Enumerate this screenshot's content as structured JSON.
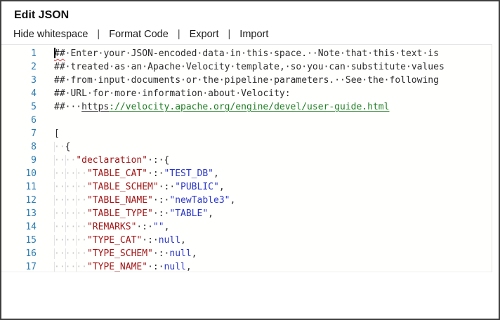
{
  "dialog": {
    "title": "Edit JSON"
  },
  "toolbar": {
    "separator": "|",
    "items": [
      {
        "label": "Hide whitespace"
      },
      {
        "label": "Format Code"
      },
      {
        "label": "Export"
      },
      {
        "label": "Import"
      }
    ]
  },
  "colors": {
    "line_number": "#2c7cb0",
    "json_key": "#a31515",
    "json_value": "#2b38cb",
    "link_green": "#1f7e23",
    "squiggle_red": "#e23b3b",
    "whitespace_dot": "#c6c6c6",
    "indent_guide": "#e3e3e3"
  },
  "editor": {
    "link_url": "https://velocity.apache.org/engine/devel/user-guide.html",
    "lines": [
      {
        "n": "1",
        "indent": 0,
        "cursor": true,
        "segments": [
          {
            "t": "##",
            "c": "comment sq"
          },
          {
            "t": " Enter your JSON-encoded data in this space.  Note that this text is",
            "c": "comment"
          }
        ]
      },
      {
        "n": "2",
        "indent": 0,
        "segments": [
          {
            "t": "## treated as an Apache Velocity template, so you can substitute values",
            "c": "comment"
          }
        ]
      },
      {
        "n": "3",
        "indent": 0,
        "segments": [
          {
            "t": "## from input documents or the pipeline parameters.  See the following",
            "c": "comment"
          }
        ]
      },
      {
        "n": "4",
        "indent": 0,
        "segments": [
          {
            "t": "## URL for more information about Velocity:",
            "c": "comment"
          }
        ]
      },
      {
        "n": "5",
        "indent": 0,
        "segments": [
          {
            "t": "##   ",
            "c": "comment"
          },
          {
            "t": "https",
            "c": "linkproto"
          },
          {
            "t": "://velocity.apache.org/engine/devel/user-guide.html",
            "c": "link"
          }
        ]
      },
      {
        "n": "6",
        "indent": 0,
        "segments": []
      },
      {
        "n": "7",
        "indent": 0,
        "segments": [
          {
            "t": "[",
            "c": "plain"
          }
        ]
      },
      {
        "n": "8",
        "indent": 2,
        "segments": [
          {
            "t": "{",
            "c": "plain"
          }
        ]
      },
      {
        "n": "9",
        "indent": 4,
        "segments": [
          {
            "t": "\"declaration\"",
            "c": "key"
          },
          {
            "t": " : {",
            "c": "plain"
          }
        ]
      },
      {
        "n": "10",
        "indent": 6,
        "segments": [
          {
            "t": "\"TABLE_CAT\"",
            "c": "key"
          },
          {
            "t": " : ",
            "c": "plain"
          },
          {
            "t": "\"TEST_DB\"",
            "c": "str"
          },
          {
            "t": ",",
            "c": "plain"
          }
        ]
      },
      {
        "n": "11",
        "indent": 6,
        "segments": [
          {
            "t": "\"TABLE_SCHEM\"",
            "c": "key"
          },
          {
            "t": " : ",
            "c": "plain"
          },
          {
            "t": "\"PUBLIC\"",
            "c": "str"
          },
          {
            "t": ",",
            "c": "plain"
          }
        ]
      },
      {
        "n": "12",
        "indent": 6,
        "segments": [
          {
            "t": "\"TABLE_NAME\"",
            "c": "key"
          },
          {
            "t": " : ",
            "c": "plain"
          },
          {
            "t": "\"newTable3\"",
            "c": "str"
          },
          {
            "t": ",",
            "c": "plain"
          }
        ]
      },
      {
        "n": "13",
        "indent": 6,
        "segments": [
          {
            "t": "\"TABLE_TYPE\"",
            "c": "key"
          },
          {
            "t": " : ",
            "c": "plain"
          },
          {
            "t": "\"TABLE\"",
            "c": "str"
          },
          {
            "t": ",",
            "c": "plain"
          }
        ]
      },
      {
        "n": "14",
        "indent": 6,
        "segments": [
          {
            "t": "\"REMARKS\"",
            "c": "key"
          },
          {
            "t": " : ",
            "c": "plain"
          },
          {
            "t": "\"\"",
            "c": "str"
          },
          {
            "t": ",",
            "c": "plain"
          }
        ]
      },
      {
        "n": "15",
        "indent": 6,
        "segments": [
          {
            "t": "\"TYPE_CAT\"",
            "c": "key"
          },
          {
            "t": " : ",
            "c": "plain"
          },
          {
            "t": "null",
            "c": "kw"
          },
          {
            "t": ",",
            "c": "plain"
          }
        ]
      },
      {
        "n": "16",
        "indent": 6,
        "segments": [
          {
            "t": "\"TYPE_SCHEM\"",
            "c": "key"
          },
          {
            "t": " : ",
            "c": "plain"
          },
          {
            "t": "null",
            "c": "kw"
          },
          {
            "t": ",",
            "c": "plain"
          }
        ]
      },
      {
        "n": "17",
        "indent": 6,
        "segments": [
          {
            "t": "\"TYPE_NAME\"",
            "c": "key"
          },
          {
            "t": " : ",
            "c": "plain"
          },
          {
            "t": "null",
            "c": "kw"
          },
          {
            "t": ",",
            "c": "plain"
          }
        ]
      }
    ]
  }
}
